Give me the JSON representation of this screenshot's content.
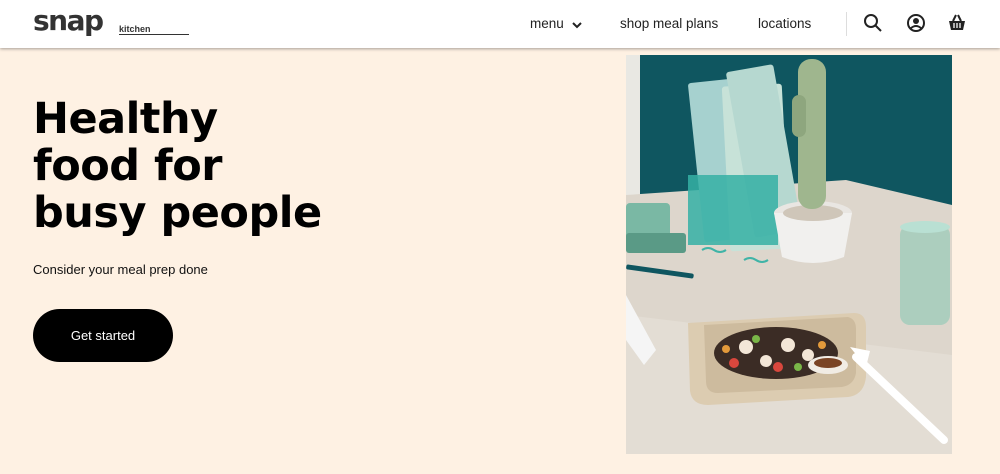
{
  "header": {
    "logo_main": "snap",
    "logo_sub": "kitchen",
    "nav": [
      {
        "label": "menu"
      },
      {
        "label": "shop meal plans"
      },
      {
        "label": "locations"
      }
    ]
  },
  "hero": {
    "title_lines": [
      "Healthy",
      "food for",
      "busy people"
    ],
    "subtitle": "Consider your meal prep done",
    "cta_label": "Get started"
  },
  "icons": {
    "search": "search-icon",
    "account": "user-circle-icon",
    "cart": "basket-icon",
    "menu_chevron": "chevron-down-icon"
  },
  "colors": {
    "hero_background": "#fef1e3",
    "cta_background": "#000000",
    "cta_text": "#ffffff",
    "wall_teal": "#0f5660"
  }
}
